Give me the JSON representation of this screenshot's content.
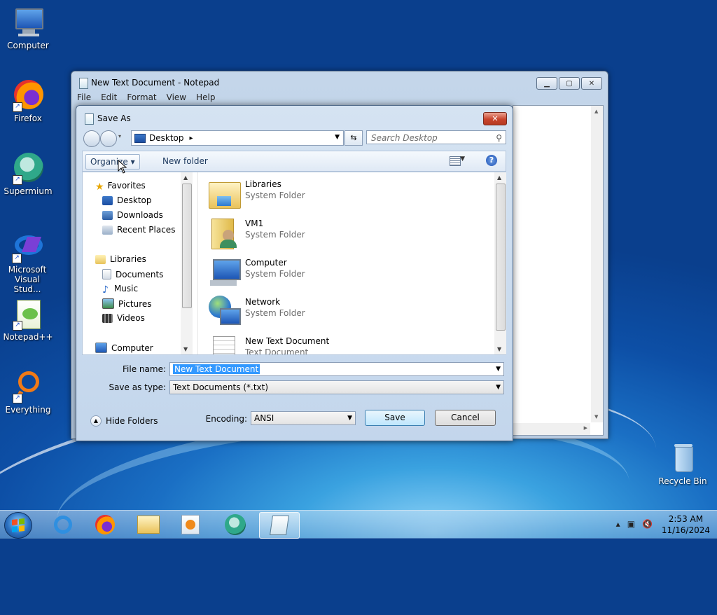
{
  "desktop": {
    "icons": [
      {
        "label": "Computer"
      },
      {
        "label": "Firefox"
      },
      {
        "label": "Supermium"
      },
      {
        "label": "Microsoft Visual Stud..."
      },
      {
        "label": "Notepad++"
      },
      {
        "label": "Everything"
      },
      {
        "label": "Recycle Bin"
      }
    ]
  },
  "notepad": {
    "title": "New Text Document - Notepad",
    "menu": [
      "File",
      "Edit",
      "Format",
      "View",
      "Help"
    ]
  },
  "dialog": {
    "title": "Save As",
    "close_glyph": "✕",
    "address": {
      "location": "Desktop",
      "sep": "▸"
    },
    "search_placeholder": "Search Desktop",
    "toolbar": {
      "organize": "Organize ▾",
      "new_folder": "New folder",
      "help": "?"
    },
    "nav": {
      "favorites": "Favorites",
      "desktop": "Desktop",
      "downloads": "Downloads",
      "recent": "Recent Places",
      "libraries": "Libraries",
      "documents": "Documents",
      "music": "Music",
      "pictures": "Pictures",
      "videos": "Videos",
      "computer": "Computer"
    },
    "files": [
      {
        "name": "Libraries",
        "type": "System Folder"
      },
      {
        "name": "VM1",
        "type": "System Folder"
      },
      {
        "name": "Computer",
        "type": "System Folder"
      },
      {
        "name": "Network",
        "type": "System Folder"
      },
      {
        "name": "New Text Document",
        "type": "Text Document"
      }
    ],
    "file_name_label": "File name:",
    "file_name_value": "New Text Document",
    "save_type_label": "Save as type:",
    "save_type_value": "Text Documents (*.txt)",
    "hide_folders": "Hide Folders",
    "encoding_label": "Encoding:",
    "encoding_value": "ANSI",
    "save_label": "Save",
    "cancel_label": "Cancel"
  },
  "taskbar": {
    "time": "2:53 AM",
    "date": "11/16/2024"
  },
  "colors": {
    "accent": "#3399ff",
    "close_red": "#c8442d",
    "desktop_blue": "#1a6fc4"
  }
}
